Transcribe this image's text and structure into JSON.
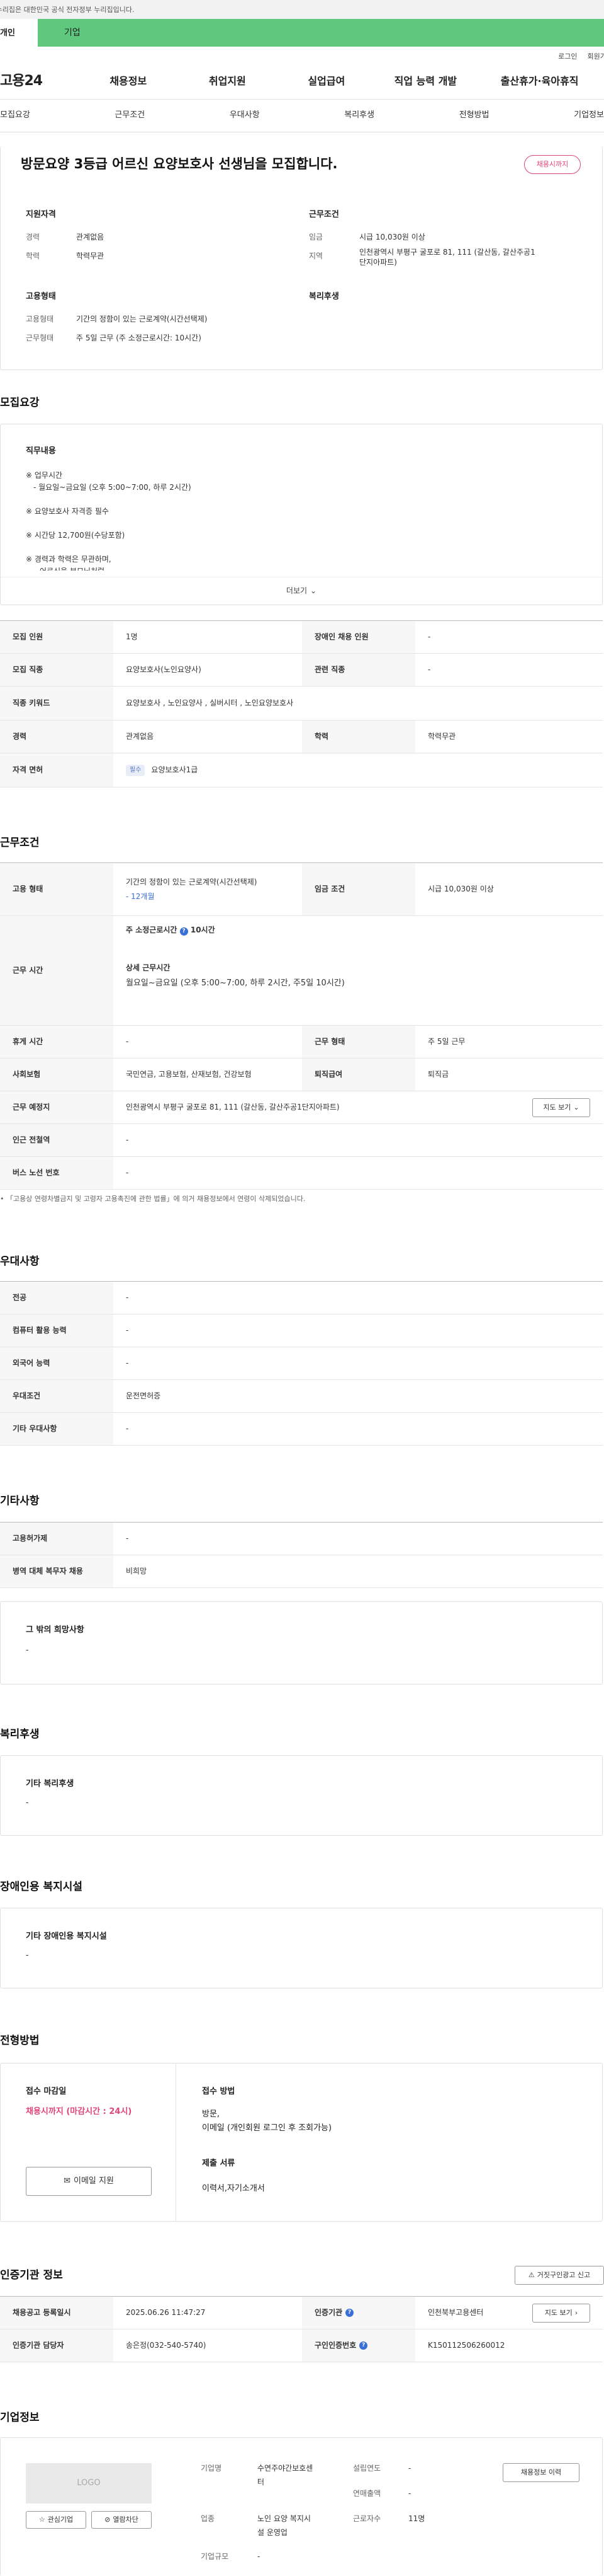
{
  "gov_banner": "이 누리집은 대한민국 공식 전자정부 누리집입니다.",
  "user_tabs": [
    "개인",
    "기업"
  ],
  "top_links": [
    "로그인",
    "회원가입"
  ],
  "logo": "고용24",
  "gnb": [
    "채용정보",
    "취업지원",
    "실업급여",
    "직업 능력 개발",
    "출산휴가·육아휴직"
  ],
  "subnav": [
    "모집요강",
    "근무조건",
    "우대사항",
    "복리후생",
    "전형방법",
    "기업정보"
  ],
  "job": {
    "title": "방문요양 3등급 어르신 요양보호사 선생님을 모집합니다.",
    "status_badge": "채용시까지",
    "qual_title": "지원자격",
    "career_l": "경력",
    "career_v": "관계없음",
    "edu_l": "학력",
    "edu_v": "학력무관",
    "cond_title": "근무조건",
    "wage_l": "임금",
    "wage_v": "시급 10,030원 이상",
    "region_l": "지역",
    "region_v1": "인천광역시 부평구 굴포로 81, 111 (갈산동, 갈산주공1",
    "region_v2": "단지아파트)",
    "emp_title": "고용형태",
    "emptype_l": "고용형태",
    "emptype_v": "기간의 정함이 있는 근로계약(시간선택제)",
    "worktype_l": "근무형태",
    "worktype_v": "주 5일 근무 (주 소정근로시간: 10시간)",
    "welfare_title": "복리후생"
  },
  "recruit": {
    "title": "모집요강",
    "duty_title": "직무내용",
    "duty_lines": [
      "※ 업무시간",
      "- 월요일~금요일 (오후 5:00~7:00, 하루 2시간)",
      "",
      "※ 요양보호사 자격증 필수",
      "",
      "※ 시간당 12,700원(수당포함)",
      "",
      "※ 경력과 학력은 무관하며,",
      "어르신을 부모님처럼"
    ],
    "more": "더보기",
    "rows": [
      {
        "th": "모집 인원",
        "td": "1명",
        "th2": "장애인 채용 인원",
        "td2": "-"
      },
      {
        "th": "모집 직종",
        "td": "요양보호사(노인요양사)",
        "th2": "관련 직종",
        "td2": "-"
      },
      {
        "th": "직종 키워드",
        "td": "요양보호사 , 노인요양사 , 실버시터 , 노인요양보호사"
      },
      {
        "th": "경력",
        "td": "관계없음",
        "th2": "학력",
        "td2": "학력무관"
      },
      {
        "th": "자격 면허",
        "badge": "필수",
        "td": "요양보호사1급"
      }
    ]
  },
  "work": {
    "title": "근무조건",
    "emptype_th": "고용 형태",
    "emptype_td": "기간의 정함이 있는 근로계약(시간선택제)",
    "emptype_sub": "- 12개월",
    "wage_th": "임금 조건",
    "wage_td": "시급 10,030원 이상",
    "hours_th": "근무 시간",
    "hours_main": "주 소정근로시간",
    "hours_val": "10시간",
    "hours_detail_title": "상세 근무시간",
    "hours_detail": "월요일~금요일 (오후 5:00~7:00, 하루 2시간, 주5일 10시간)",
    "rest_th": "휴게 시간",
    "rest_td": "-",
    "form_th": "근무 형태",
    "form_td": "주 5일 근무",
    "ins_th": "사회보험",
    "ins_td": "국민연금, 고용보험, 산재보험, 건강보험",
    "ret_th": "퇴직급여",
    "ret_td": "퇴직금",
    "place_th": "근무 예정지",
    "place_td": "인천광역시 부평구 굴포로 81, 111 (갈산동, 갈산주공1단지아파트)",
    "map_btn": "지도 보기",
    "station_th": "인근 전철역",
    "station_td": "-",
    "bus_th": "버스 노선 번호",
    "bus_td": "-",
    "note": "「고용상 연령차별금지 및 고령자 고용촉진에 관한 법률」에 의거 채용정보에서 연령이 삭제되었습니다."
  },
  "pref": {
    "title": "우대사항",
    "rows": [
      {
        "th": "전공",
        "td": "-"
      },
      {
        "th": "컴퓨터 활용 능력",
        "td": "-"
      },
      {
        "th": "외국어 능력",
        "td": "-"
      },
      {
        "th": "우대조건",
        "td": "운전면허증"
      },
      {
        "th": "기타 우대사항",
        "td": "-"
      }
    ]
  },
  "etc": {
    "title": "기타사항",
    "rows": [
      {
        "th": "고용허가제",
        "td": "-"
      },
      {
        "th": "병역 대체 복무자 채용",
        "td": "비희망"
      }
    ],
    "hope_title": "그 밖의 희망사항",
    "hope_val": "-"
  },
  "welfare": {
    "title": "복리후생",
    "box_title": "기타 복리후생",
    "box_val": "-"
  },
  "disabled": {
    "title": "장애인용 복지시설",
    "box_title": "기타 장애인용 복지시설",
    "box_val": "-"
  },
  "selection": {
    "title": "전형방법",
    "deadline_l": "접수 마감일",
    "deadline_v": "채용시까지 (마감시간 : 24시)",
    "email_btn": "이메일 지원",
    "method_l": "접수 방법",
    "method_v1": "방문,",
    "method_v2": "이메일 (개인회원 로그인 후 조회가능)",
    "docs_l": "제출 서류",
    "docs_v": "이력서,자기소개서"
  },
  "agency": {
    "title": "인증기관 정보",
    "report_btn": "거짓구인광고 신고",
    "reg_th": "채용공고 등록일시",
    "reg_td": "2025.06.26 11:47:27",
    "org_th": "인증기관",
    "org_td": "인천북부고용센터",
    "map_btn": "지도 보기",
    "mgr_th": "인증기관 담당자",
    "mgr_td": "송은정(032-540-5740)",
    "num_th": "구인인증번호",
    "num_td": "K150112506260012"
  },
  "company": {
    "title": "기업정보",
    "logo_text": "LOGO",
    "interest_btn": "관심기업",
    "block_btn": "열람차단",
    "name_l": "기업명",
    "name_v1": "수연주야간보호센",
    "name_v2": "터",
    "found_l": "설립연도",
    "found_v": "-",
    "ind_l": "업종",
    "ind_v1": "노인 요양 복지시",
    "ind_v2": "설 운영업",
    "sales_l": "연매출액",
    "sales_v": "-",
    "emp_l": "근로자수",
    "emp_v": "11명",
    "size_l": "기업규모",
    "size_v": "-",
    "history_btn": "채용정보 이력"
  }
}
